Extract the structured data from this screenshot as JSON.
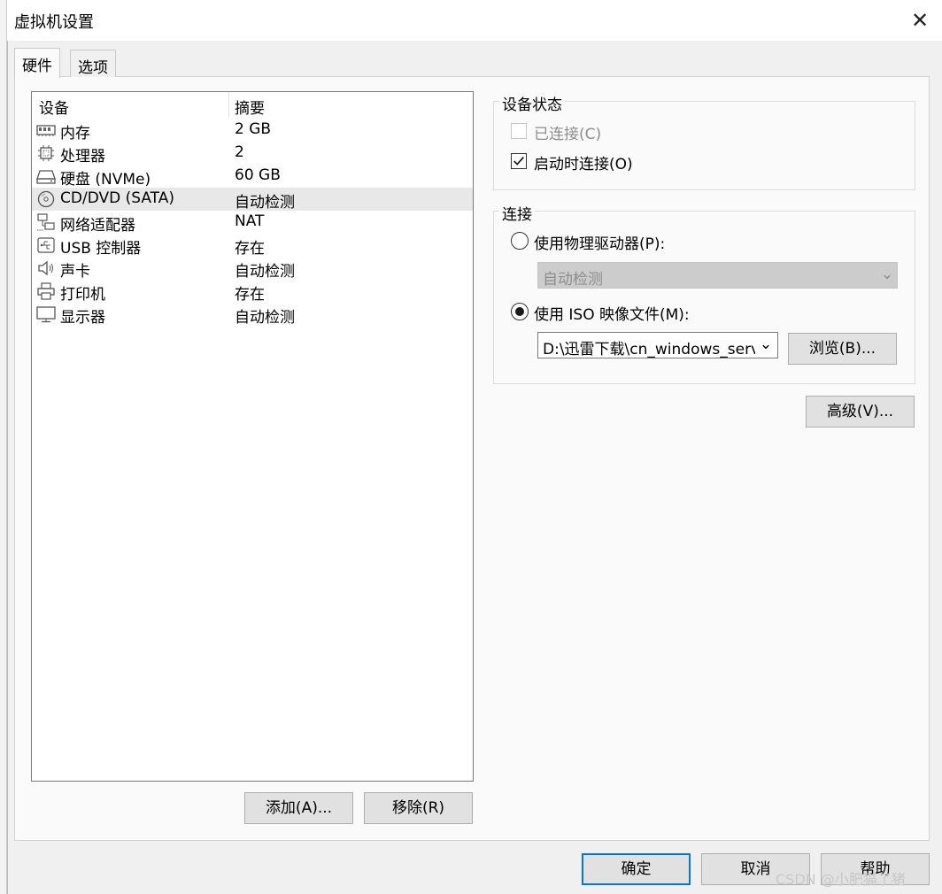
{
  "window": {
    "title": "虚拟机设置",
    "close_icon": "close-icon"
  },
  "tabs": [
    {
      "label": "硬件",
      "active": true
    },
    {
      "label": "选项",
      "active": false
    }
  ],
  "device_list": {
    "columns": [
      "设备",
      "摘要"
    ],
    "rows": [
      {
        "icon": "memory-icon",
        "name": "内存",
        "summary": "2 GB",
        "selected": false
      },
      {
        "icon": "cpu-icon",
        "name": "处理器",
        "summary": "2",
        "selected": false
      },
      {
        "icon": "disk-icon",
        "name": "硬盘 (NVMe)",
        "summary": "60 GB",
        "selected": false
      },
      {
        "icon": "cd-icon",
        "name": "CD/DVD (SATA)",
        "summary": "自动检测",
        "selected": true
      },
      {
        "icon": "network-icon",
        "name": "网络适配器",
        "summary": "NAT",
        "selected": false
      },
      {
        "icon": "usb-icon",
        "name": "USB 控制器",
        "summary": "存在",
        "selected": false
      },
      {
        "icon": "speaker-icon",
        "name": "声卡",
        "summary": "自动检测",
        "selected": false
      },
      {
        "icon": "printer-icon",
        "name": "打印机",
        "summary": "存在",
        "selected": false
      },
      {
        "icon": "monitor-icon",
        "name": "显示器",
        "summary": "自动检测",
        "selected": false
      }
    ]
  },
  "list_buttons": {
    "add": "添加(A)...",
    "remove": "移除(R)"
  },
  "device_status": {
    "label": "设备状态",
    "connected": {
      "label": "已连接(C)",
      "checked": false,
      "disabled": true
    },
    "connect_at_power_on": {
      "label": "启动时连接(O)",
      "checked": true
    }
  },
  "connection": {
    "label": "连接",
    "physical": {
      "label": "使用物理驱动器(P):",
      "selected": false,
      "combo_value": "自动检测"
    },
    "iso": {
      "label": "使用 ISO 映像文件(M):",
      "selected": true,
      "path": "D:\\迅雷下载\\cn_windows_serv"
    },
    "browse": "浏览(B)..."
  },
  "advanced": "高级(V)...",
  "footer": {
    "ok": "确定",
    "cancel": "取消",
    "help": "帮助"
  },
  "watermark": "CSDN @小肥猫了猪",
  "colors": {
    "accent": "#0078d7",
    "selection": "#e8e8e8",
    "panel": "#fafafa",
    "dialog": "#f0f0f0"
  }
}
